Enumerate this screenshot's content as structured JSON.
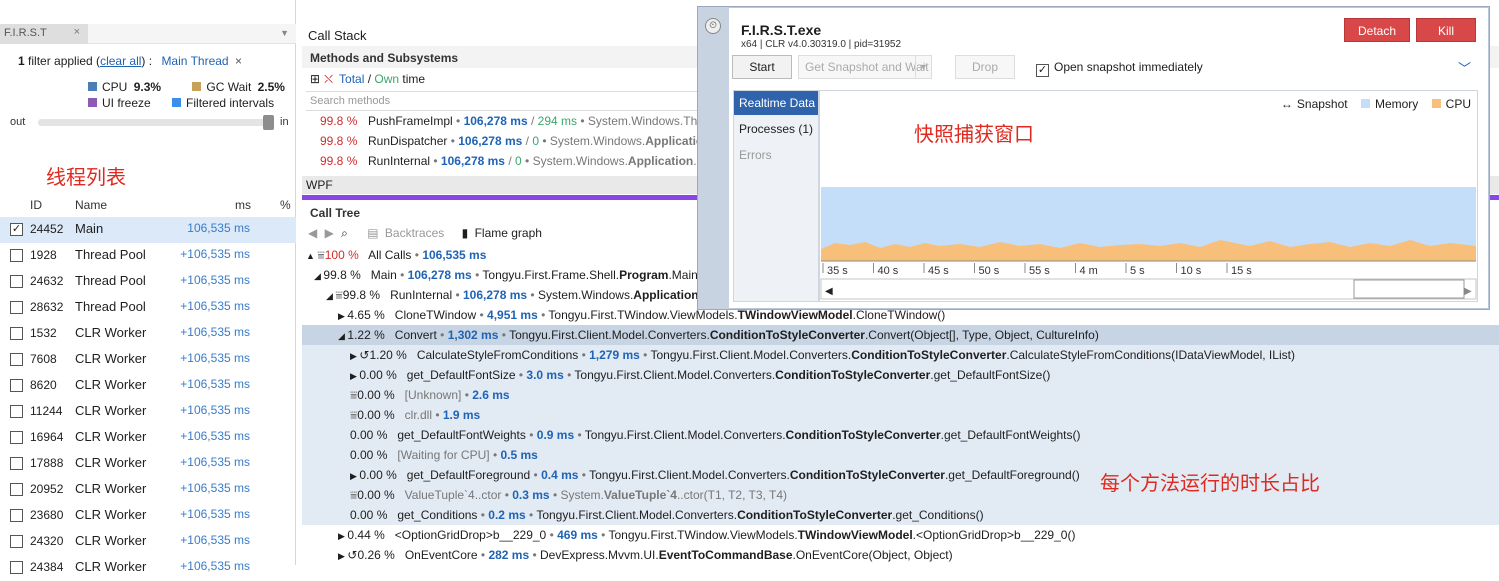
{
  "left_panel": {
    "tab_title": "F.I.R.S.T",
    "tab_close": "×",
    "filter": {
      "prefix": "1",
      "text": " filter applied (",
      "clear_all": "clear all",
      "suffix": ") :",
      "value": "Main Thread",
      "remove": "×"
    },
    "legend": {
      "cpu_label": "CPU",
      "cpu_value": "9.3%",
      "gc_label": "GC Wait",
      "gc_value": "2.5%",
      "ui_freeze": "UI freeze",
      "filtered": "Filtered intervals",
      "cpu_color": "#4a7fb5",
      "gc_color": "#c8a25a",
      "ui_color": "#8d5ab5",
      "filtered_color": "#3c8fe8"
    },
    "zoom": {
      "out": "out",
      "in": "in",
      "level": 0.95
    },
    "annotation": "线程列表",
    "columns": {
      "id": "ID",
      "name": "Name",
      "ms": "ms",
      "pct": "%"
    },
    "threads": [
      {
        "id": "24452",
        "name": "Main",
        "ms": "106,535 ms",
        "checked": true
      },
      {
        "id": "1928",
        "name": "Thread Pool",
        "ms": "+106,535 ms",
        "checked": false
      },
      {
        "id": "24632",
        "name": "Thread Pool",
        "ms": "+106,535 ms",
        "checked": false
      },
      {
        "id": "28632",
        "name": "Thread Pool",
        "ms": "+106,535 ms",
        "checked": false
      },
      {
        "id": "1532",
        "name": "CLR Worker",
        "ms": "+106,535 ms",
        "checked": false
      },
      {
        "id": "7608",
        "name": "CLR Worker",
        "ms": "+106,535 ms",
        "checked": false
      },
      {
        "id": "8620",
        "name": "CLR Worker",
        "ms": "+106,535 ms",
        "checked": false
      },
      {
        "id": "11244",
        "name": "CLR Worker",
        "ms": "+106,535 ms",
        "checked": false
      },
      {
        "id": "16964",
        "name": "CLR Worker",
        "ms": "+106,535 ms",
        "checked": false
      },
      {
        "id": "17888",
        "name": "CLR Worker",
        "ms": "+106,535 ms",
        "checked": false
      },
      {
        "id": "20952",
        "name": "CLR Worker",
        "ms": "+106,535 ms",
        "checked": false
      },
      {
        "id": "23680",
        "name": "CLR Worker",
        "ms": "+106,535 ms",
        "checked": false
      },
      {
        "id": "24320",
        "name": "CLR Worker",
        "ms": "+106,535 ms",
        "checked": false
      },
      {
        "id": "24384",
        "name": "CLR Worker",
        "ms": "+106,535 ms",
        "checked": false
      }
    ]
  },
  "call_stack": {
    "title": "Call Stack",
    "subtitle": "Methods and Subsystems",
    "total": "Total",
    "slash": " / ",
    "own": "Own",
    "time": " time",
    "search_placeholder": "Search methods",
    "rows": [
      {
        "pct": "99.8 %",
        "fn": "PushFrameImpl",
        "ms": "106,278 ms",
        "own": "294 ms",
        "ns": "System.Windows.Threading.Dispatcher"
      },
      {
        "pct": "99.8 %",
        "fn": "RunDispatcher",
        "ms": "106,278 ms",
        "own": "0",
        "ns_pre": "System.Windows.",
        "ns_bold": "Application"
      },
      {
        "pct": "99.8 %",
        "fn": "RunInternal",
        "ms": "106,278 ms",
        "own": "0",
        "ns_pre": "System.Windows.",
        "ns_bold": "Application",
        "ns_post": ".RunInternal"
      }
    ],
    "wpf_label": "WPF"
  },
  "call_tree": {
    "title": "Call Tree",
    "backtraces": "Backtraces",
    "flame_graph": "Flame graph",
    "rows": [
      {
        "arrow": "▲",
        "filter": "⩸",
        "pct": "100 %",
        "name": "All Calls",
        "ms": "106,535 ms",
        "rest": "",
        "red": true
      },
      {
        "arrow": "◢",
        "pct": "99.8 %",
        "name": "Main",
        "ms": "106,278 ms",
        "rest_pre": "Tongyu.First.Frame.Shell.",
        "rest_bold": "Program",
        "rest_post": ".Main()"
      },
      {
        "arrow": "◢",
        "filter": "⩸",
        "pct": "99.8 %",
        "name": "RunInternal",
        "ms": "106,278 ms",
        "rest_pre": "System.Windows.",
        "rest_bold": "Application",
        "rest_post": ".RunInternal(Window)"
      },
      {
        "arrow": "▶",
        "pct": "4.65 %",
        "name": "CloneTWindow",
        "ms": "4,951 ms",
        "rest_pre": "Tongyu.First.TWindow.ViewModels.",
        "rest_bold": "TWindowViewModel",
        "rest_post": ".CloneTWindow()"
      },
      {
        "arrow": "◢",
        "pct": "1.22 %",
        "name": "Convert",
        "ms": "1,302 ms",
        "rest_pre": "Tongyu.First.Client.Model.Converters.",
        "rest_bold": "ConditionToStyleConverter",
        "rest_post": ".Convert(Object[], Type, Object, CultureInfo)"
      },
      {
        "arrow": "▶",
        "rec": "↺",
        "pct": "1.20 %",
        "name": "CalculateStyleFromConditions",
        "ms": "1,279 ms",
        "rest_pre": "Tongyu.First.Client.Model.Converters.",
        "rest_bold": "ConditionToStyleConverter",
        "rest_post": ".CalculateStyleFromConditions(IDataViewModel, IList)"
      },
      {
        "arrow": "▶",
        "pct": "0.00 %",
        "name": "get_DefaultFontSize",
        "ms": "3.0 ms",
        "rest_pre": "Tongyu.First.Client.Model.Converters.",
        "rest_bold": "ConditionToStyleConverter",
        "rest_post": ".get_DefaultFontSize()"
      },
      {
        "filter": "⩸",
        "pct": "0.00 %",
        "name": "[Unknown]",
        "ms": "2.6 ms",
        "gray": true
      },
      {
        "filter": "⩸",
        "pct": "0.00 %",
        "name": "clr.dll",
        "ms": "1.9 ms",
        "gray": true
      },
      {
        "pct": "0.00 %",
        "name": "get_DefaultFontWeights",
        "ms": "0.9 ms",
        "rest_pre": "Tongyu.First.Client.Model.Converters.",
        "rest_bold": "ConditionToStyleConverter",
        "rest_post": ".get_DefaultFontWeights()"
      },
      {
        "pct": "0.00 %",
        "name": "[Waiting for CPU]",
        "ms": "0.5 ms",
        "gray": true
      },
      {
        "arrow": "▶",
        "pct": "0.00 %",
        "name": "get_DefaultForeground",
        "ms": "0.4 ms",
        "rest_pre": "Tongyu.First.Client.Model.Converters.",
        "rest_bold": "ConditionToStyleConverter",
        "rest_post": ".get_DefaultForeground()"
      },
      {
        "filter": "⩸",
        "pct": "0.00 %",
        "name": "ValueTuple`4..ctor",
        "ms": "0.3 ms",
        "gray": true,
        "rest_pre": "System.",
        "rest_bold": "ValueTuple`4",
        "rest_post": "..ctor(T1, T2, T3, T4)",
        "rest_gray": true
      },
      {
        "pct": "0.00 %",
        "name": "get_Conditions",
        "ms": "0.2 ms",
        "rest_pre": "Tongyu.First.Client.Model.Converters.",
        "rest_bold": "ConditionToStyleConverter",
        "rest_post": ".get_Conditions()"
      },
      {
        "arrow": "▶",
        "pct": "0.44 %",
        "name": "<OptionGridDrop>b__229_0",
        "ms": "469 ms",
        "rest_pre": "Tongyu.First.TWindow.ViewModels.",
        "rest_bold": "TWindowViewModel",
        "rest_post": ".<OptionGridDrop>b__229_0()"
      },
      {
        "arrow": "▶",
        "rec": "↺",
        "pct": "0.26 %",
        "name": "OnEventCore",
        "ms": "282 ms",
        "rest_pre": "DevExpress.Mvvm.UI.",
        "rest_bold": "EventToCommandBase",
        "rest_post": ".OnEventCore(Object, Object)"
      }
    ],
    "annotation": "每个方法运行的时长占比"
  },
  "snapshot": {
    "title": "F.I.R.S.T.exe",
    "subtitle": "x64 | CLR v4.0.30319.0 | pid=31952",
    "detach": "Detach",
    "kill": "Kill",
    "start": "Start",
    "get_snapshot": "Get Snapshot and Wait",
    "drop": "Drop",
    "open_immediately": "Open snapshot immediately",
    "tabs": [
      "Realtime Data",
      "Processes (1)",
      "Errors"
    ],
    "legend": {
      "snapshot": "Snapshot",
      "memory": "Memory",
      "cpu": "CPU"
    },
    "memory_color": "#c4defa",
    "cpu_color": "#f7bf7a",
    "ticks": [
      "35 s",
      "40 s",
      "45 s",
      "50 s",
      "55 s",
      "4 m",
      "5 s",
      "10 s",
      "15 s"
    ],
    "annotation": "快照捕获窗口"
  }
}
